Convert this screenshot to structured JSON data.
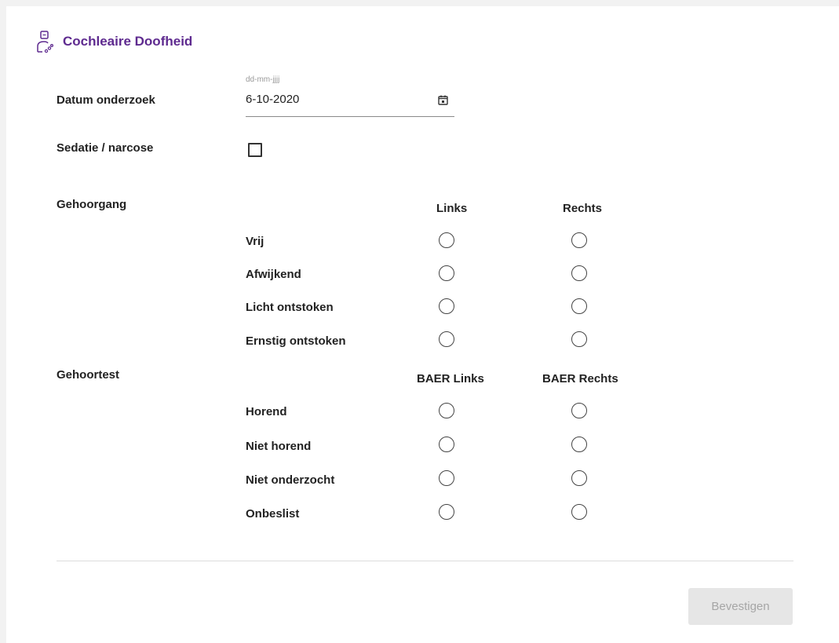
{
  "header": {
    "title": "Cochleaire Doofheid",
    "icon": "doctor-icon",
    "accent_color": "#5e2a8f"
  },
  "date": {
    "label": "Datum onderzoek",
    "placeholder": "dd-mm-jjjj",
    "value": "6-10-2020",
    "icon": "calendar-icon"
  },
  "sedation": {
    "label": "Sedatie / narcose",
    "checked": false
  },
  "gehoorgang": {
    "title": "Gehoorgang",
    "columns": [
      "Links",
      "Rechts"
    ],
    "rows": [
      "Vrij",
      "Afwijkend",
      "Licht ontstoken",
      "Ernstig ontstoken"
    ]
  },
  "gehoortest": {
    "title": "Gehoortest",
    "columns": [
      "BAER Links",
      "BAER Rechts"
    ],
    "rows": [
      "Horend",
      "Niet horend",
      "Niet onderzocht",
      "Onbeslist"
    ]
  },
  "actions": {
    "confirm_label": "Bevestigen",
    "confirm_enabled": false
  }
}
